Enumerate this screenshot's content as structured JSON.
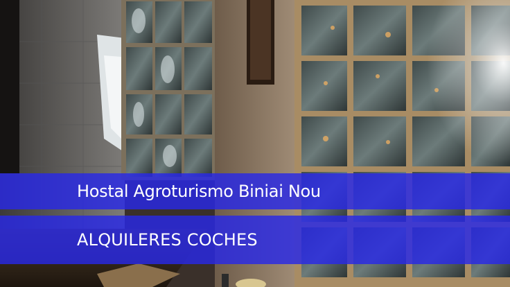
{
  "banner": {
    "title": "Hostal Agroturismo Biniai Nou",
    "subtitle": "ALQUILERES COCHES"
  },
  "colors": {
    "banner_blue": "#2828e6",
    "wall": "#8a7a66",
    "glass": "#5a6a6c",
    "grout": "#b59a72"
  }
}
